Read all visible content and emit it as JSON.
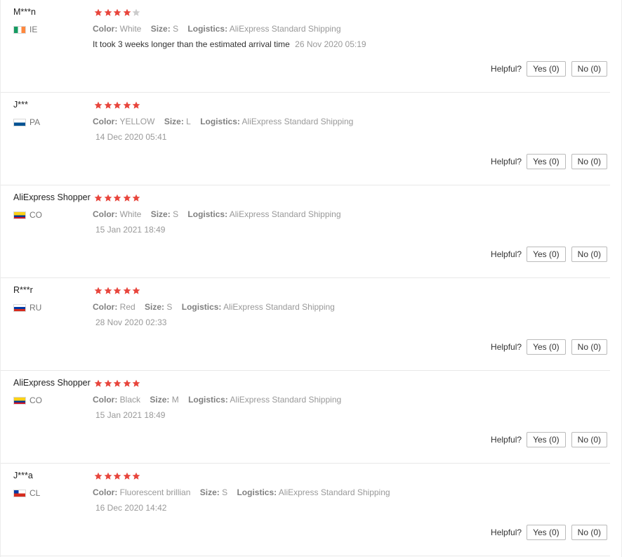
{
  "helpful_label": "Helpful?",
  "labels": {
    "color": "Color:",
    "size": "Size:",
    "logistics": "Logistics:"
  },
  "colors": {
    "star_filled": "#e8453c",
    "star_empty": "#cccccc"
  },
  "reviews": [
    {
      "user": "M***n",
      "country_code": "IE",
      "flag_colors": [
        "#169b62",
        "#ffffff",
        "#ff883e"
      ],
      "rating": 4,
      "color": "White",
      "size": "S",
      "logistics": "AliExpress Standard Shipping",
      "text": "It took 3 weeks longer than the estimated arrival time",
      "date": "26 Nov 2020 05:19",
      "yes": "Yes (0)",
      "no": "No (0)"
    },
    {
      "user": "J***",
      "country_code": "PA",
      "flag_colors": [
        "#ffffff",
        "#d21034",
        "#005293"
      ],
      "rating": 5,
      "color": "YELLOW",
      "size": "L",
      "logistics": "AliExpress Standard Shipping",
      "text": "",
      "date": "14 Dec 2020 05:41",
      "yes": "Yes (0)",
      "no": "No (0)"
    },
    {
      "user": "AliExpress Shopper",
      "country_code": "CO",
      "flag_colors": [
        "#fcd116",
        "#003893",
        "#ce1126"
      ],
      "rating": 5,
      "color": "White",
      "size": "S",
      "logistics": "AliExpress Standard Shipping",
      "text": "",
      "date": "15 Jan 2021 18:49",
      "yes": "Yes (0)",
      "no": "No (0)"
    },
    {
      "user": "R***r",
      "country_code": "RU",
      "flag_colors": [
        "#ffffff",
        "#0039a6",
        "#d52b1e"
      ],
      "rating": 5,
      "color": "Red",
      "size": "S",
      "logistics": "AliExpress Standard Shipping",
      "text": "",
      "date": "28 Nov 2020 02:33",
      "yes": "Yes (0)",
      "no": "No (0)"
    },
    {
      "user": "AliExpress Shopper",
      "country_code": "CO",
      "flag_colors": [
        "#fcd116",
        "#003893",
        "#ce1126"
      ],
      "rating": 5,
      "color": "Black",
      "size": "M",
      "logistics": "AliExpress Standard Shipping",
      "text": "",
      "date": "15 Jan 2021 18:49",
      "yes": "Yes (0)",
      "no": "No (0)"
    },
    {
      "user": "J***a",
      "country_code": "CL",
      "flag_colors": [
        "#0039a6",
        "#ffffff",
        "#d52b1e"
      ],
      "rating": 5,
      "color": "Fluorescent brillian",
      "size": "S",
      "logistics": "AliExpress Standard Shipping",
      "text": "",
      "date": "16 Dec 2020 14:42",
      "yes": "Yes (0)",
      "no": "No (0)"
    }
  ]
}
